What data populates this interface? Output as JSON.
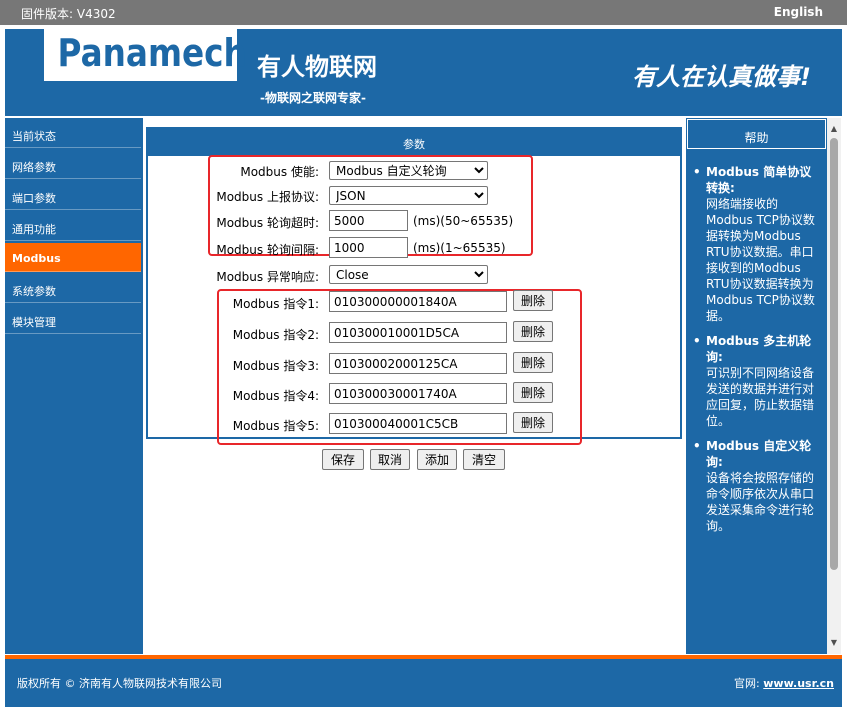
{
  "topbar": {
    "version": "固件版本: V4302",
    "language": "English"
  },
  "header": {
    "logo": "Panamech",
    "brand": "有人物联网",
    "slogan_small": "-物联网之联网专家-",
    "slogan_big": "有人在认真做事!"
  },
  "sidebar": {
    "items": [
      {
        "label": "当前状态"
      },
      {
        "label": "网络参数"
      },
      {
        "label": "端口参数"
      },
      {
        "label": "通用功能"
      },
      {
        "label": "Modbus",
        "active": true
      },
      {
        "label": "系统参数"
      },
      {
        "label": "模块管理"
      }
    ]
  },
  "panel": {
    "title": "参数",
    "enable": {
      "label": "Modbus 使能:",
      "value": "Modbus 自定义轮询"
    },
    "report": {
      "label": "Modbus 上报协议:",
      "value": "JSON"
    },
    "timeout": {
      "label": "Modbus 轮询超时:",
      "value": "5000",
      "unit": "(ms)(50~65535)"
    },
    "interval": {
      "label": "Modbus 轮询间隔:",
      "value": "1000",
      "unit": "(ms)(1~65535)"
    },
    "exception": {
      "label": "Modbus 异常响应:",
      "value": "Close"
    },
    "commands": [
      {
        "label": "Modbus 指令1:",
        "value": "010300000001840A",
        "delete": "删除"
      },
      {
        "label": "Modbus 指令2:",
        "value": "010300010001D5CA",
        "delete": "删除"
      },
      {
        "label": "Modbus 指令3:",
        "value": "01030002000125CA",
        "delete": "删除"
      },
      {
        "label": "Modbus 指令4:",
        "value": "010300030001740A",
        "delete": "删除"
      },
      {
        "label": "Modbus 指令5:",
        "value": "010300040001C5CB",
        "delete": "删除"
      }
    ]
  },
  "actions": {
    "save": "保存",
    "cancel": "取消",
    "add": "添加",
    "clear": "清空"
  },
  "help": {
    "title": "帮助",
    "items": [
      {
        "title": "Modbus 简单协议转换:",
        "text": "网络端接收的Modbus TCP协议数据转换为Modbus RTU协议数据。串口接收到的Modbus RTU协议数据转换为Modbus TCP协议数据。"
      },
      {
        "title": "Modbus 多主机轮询:",
        "text": "可识别不同网络设备发送的数据并进行对应回复，防止数据错位。"
      },
      {
        "title": "Modbus 自定义轮询:",
        "text": "设备将会按照存储的命令顺序依次从串口发送采集命令进行轮询。"
      }
    ]
  },
  "footer": {
    "copyright": "版权所有 © 济南有人物联网技术有限公司",
    "site_label": "官网:",
    "site_link": "www.usr.cn"
  },
  "colors": {
    "primary": "#1d68a6",
    "accent": "#ff6600",
    "highlight_box": "#e8262a"
  }
}
